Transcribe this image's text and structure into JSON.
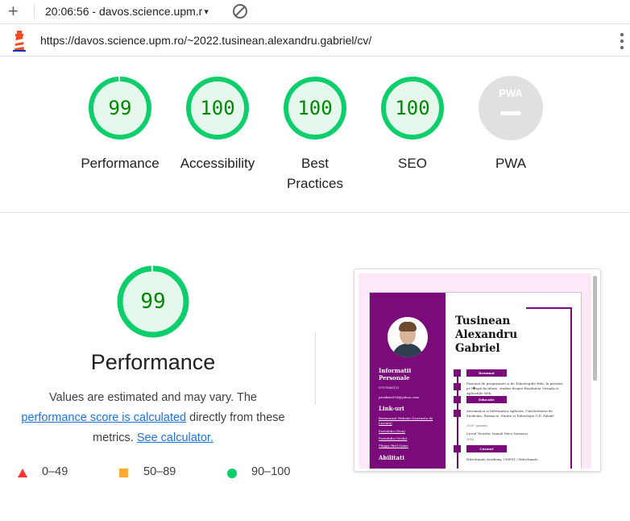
{
  "toolbar": {
    "new_icon": "plus-icon",
    "run_selector": "20:06:56 - davos.science.upm.r",
    "caret": "▾",
    "clear_icon": "block-icon"
  },
  "urlbar": {
    "logo": "lighthouse-icon",
    "url": "https://davos.science.upm.ro/~2022.tusinean.alexandru.gabriel/cv/",
    "menu_icon": "kebab-menu-icon"
  },
  "gauges": [
    {
      "value": "99",
      "score": 0.99,
      "label": "Performance"
    },
    {
      "value": "100",
      "score": 1.0,
      "label": "Accessibility"
    },
    {
      "value": "100",
      "score": 1.0,
      "label": "Best Practices"
    },
    {
      "value": "100",
      "score": 1.0,
      "label": "SEO"
    }
  ],
  "pwa": {
    "badge_text": "PWA",
    "label": "PWA"
  },
  "performance": {
    "score_text": "99",
    "score": 0.99,
    "title": "Performance",
    "desc_prefix": "Values are estimated and may vary. The",
    "link_score": "performance score is calculated",
    "desc_middle": "directly from these metrics.",
    "link_calc": "See calculator."
  },
  "legend": [
    {
      "range": "0–49",
      "shape": "triangle",
      "color": "#ff3333"
    },
    {
      "range": "50–89",
      "shape": "square",
      "color": "#ffaa33"
    },
    {
      "range": "90–100",
      "shape": "circle",
      "color": "#0cce6b"
    }
  ],
  "colors": {
    "pass_green": "#0cce6b",
    "pass_text": "#008800",
    "pass_fill": "#e6f8ee",
    "cv_purple": "#7b0a7b"
  },
  "screenshot": {
    "name": "Tusinean\nAlexandru\nGabriel",
    "side_heading_personal": "Informatii Personale",
    "phone": "0757806121",
    "email": "prosktm999@yahoo.com",
    "side_heading_links": "Link-uri",
    "links": [
      "Restaurant Website (Lucrarea de Licenta)",
      "Portofoliu (Nou)",
      "Portofoliu (Vechi)",
      "Flappy Bird Game"
    ],
    "side_heading_skills": "Abilitati",
    "tag_summary": "Rezumat",
    "summary_text": "Pasionat de programare si de Tehnologiile Web. In prezent, pe l�ngă facultate, studiez despre Realitatea Virtuala si Aplicatiile Web",
    "tag_education": "Educatie",
    "education_1": "Automatica si Informatica Aplicata, Universitatea de Medicina, Farmacie, Stiinte si Tehnologie G.E. Palade",
    "education_1_years": "2020 - prezent",
    "education_2": "Liceul Teoretic Samuil Micu Sarmasu",
    "education_2_year": "2018",
    "tag_courses": "Cursuri",
    "courses_text": "Hitechmate Academy, UMFST / Hitechmate"
  }
}
